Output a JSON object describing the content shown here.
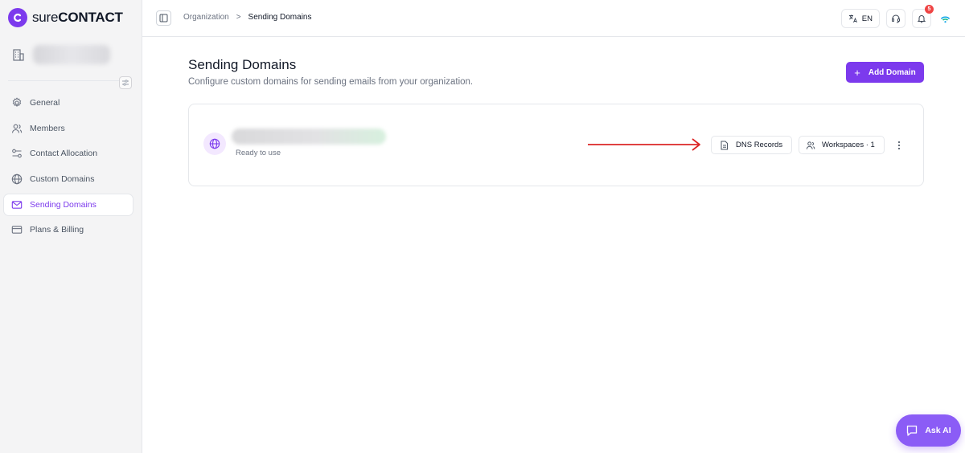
{
  "app": {
    "logo_text_light": "sure",
    "logo_text_bold": "CONTACT"
  },
  "sidebar": {
    "items": [
      {
        "label": "General",
        "icon": "gear-icon"
      },
      {
        "label": "Members",
        "icon": "users-icon"
      },
      {
        "label": "Contact Allocation",
        "icon": "allocation-icon"
      },
      {
        "label": "Custom Domains",
        "icon": "globe-icon"
      },
      {
        "label": "Sending Domains",
        "icon": "mail-icon",
        "active": true
      },
      {
        "label": "Plans & Billing",
        "icon": "card-icon"
      }
    ]
  },
  "header": {
    "breadcrumb": {
      "parent": "Organization",
      "separator": ">",
      "current": "Sending Domains"
    },
    "language": "EN",
    "notifications_count": "5"
  },
  "main": {
    "title": "Sending Domains",
    "subtitle": "Configure custom domains for sending emails from your organization.",
    "add_button": {
      "plus": "+",
      "label": "Add Domain"
    },
    "domain_card": {
      "status": "Ready to use",
      "dns_button": "DNS Records",
      "workspaces_button": "Workspaces · 1"
    }
  },
  "ask_ai": {
    "label": "Ask AI"
  },
  "colors": {
    "accent": "#7c3aed",
    "arrow": "#dc2626",
    "badge": "#ef4444"
  }
}
